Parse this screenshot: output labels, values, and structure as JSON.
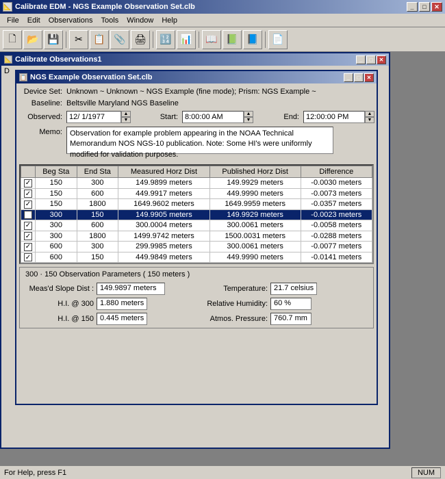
{
  "app": {
    "title": "Calibrate EDM - NGS Example Observation Set.clb",
    "icon": "📐"
  },
  "menubar": {
    "items": [
      "File",
      "Edit",
      "Observations",
      "Tools",
      "Window",
      "Help"
    ]
  },
  "calib_window": {
    "title": "Calibrate Observations1",
    "icon": "📐"
  },
  "ngs_window": {
    "title": "NGS Example Observation Set.clb",
    "icon": "📋"
  },
  "form": {
    "device_label": "Device Set:",
    "device_value": "Unknown ~ Unknown ~ NGS Example  (fine mode);  Prism: NGS Example ~",
    "baseline_label": "Baseline:",
    "baseline_value": "Beltsville Maryland NGS Baseline",
    "observed_label": "Observed:",
    "observed_value": "12/ 1/1977",
    "start_label": "Start:",
    "start_value": "8:00:00 AM",
    "end_label": "End:",
    "end_value": "12:00:00 PM",
    "memo_label": "Memo:",
    "memo_value": "Observation for example problem appearing in the NOAA Technical Memorandum NOS NGS-10 publication. Note: Some HI's were uniformly modified for validation purposes."
  },
  "table": {
    "headers": [
      "",
      "Beg Sta",
      "End Sta",
      "Measured Horz Dist",
      "Published Horz Dist",
      "Difference"
    ],
    "rows": [
      {
        "checked": true,
        "beg": "150",
        "end": "300",
        "measured": "149.9899 meters",
        "published": "149.9929 meters",
        "diff": "-0.0030 meters",
        "selected": false
      },
      {
        "checked": true,
        "beg": "150",
        "end": "600",
        "measured": "449.9917 meters",
        "published": "449.9990 meters",
        "diff": "-0.0073 meters",
        "selected": false
      },
      {
        "checked": true,
        "beg": "150",
        "end": "1800",
        "measured": "1649.9602 meters",
        "published": "1649.9959 meters",
        "diff": "-0.0357 meters",
        "selected": false
      },
      {
        "checked": true,
        "beg": "300",
        "end": "150",
        "measured": "149.9905 meters",
        "published": "149.9929 meters",
        "diff": "-0.0023 meters",
        "selected": true
      },
      {
        "checked": true,
        "beg": "300",
        "end": "600",
        "measured": "300.0004 meters",
        "published": "300.0061 meters",
        "diff": "-0.0058 meters",
        "selected": false
      },
      {
        "checked": true,
        "beg": "300",
        "end": "1800",
        "measured": "1499.9742 meters",
        "published": "1500.0031 meters",
        "diff": "-0.0288 meters",
        "selected": false
      },
      {
        "checked": true,
        "beg": "600",
        "end": "300",
        "measured": "299.9985 meters",
        "published": "300.0061 meters",
        "diff": "-0.0077 meters",
        "selected": false
      },
      {
        "checked": true,
        "beg": "600",
        "end": "150",
        "measured": "449.9849 meters",
        "published": "449.9990 meters",
        "diff": "-0.0141 meters",
        "selected": false
      }
    ]
  },
  "params": {
    "title": "300 · 150  Observation Parameters  ( 150 meters )",
    "meas_slope_label": "Meas'd Slope Dist :",
    "meas_slope_value": "149.9897 meters",
    "hi_300_label": "H.I. @ 300",
    "hi_300_value": "1.880  meters",
    "hi_150_label": "H.I. @ 150",
    "hi_150_value": "0.445  meters",
    "temp_label": "Temperature:",
    "temp_value": "21.7  celsius",
    "humidity_label": "Relative Humidity:",
    "humidity_value": "60  %",
    "pressure_label": "Atmos. Pressure:",
    "pressure_value": "760.7  mm"
  },
  "status": {
    "left": "For Help, press F1",
    "right": "NUM"
  }
}
